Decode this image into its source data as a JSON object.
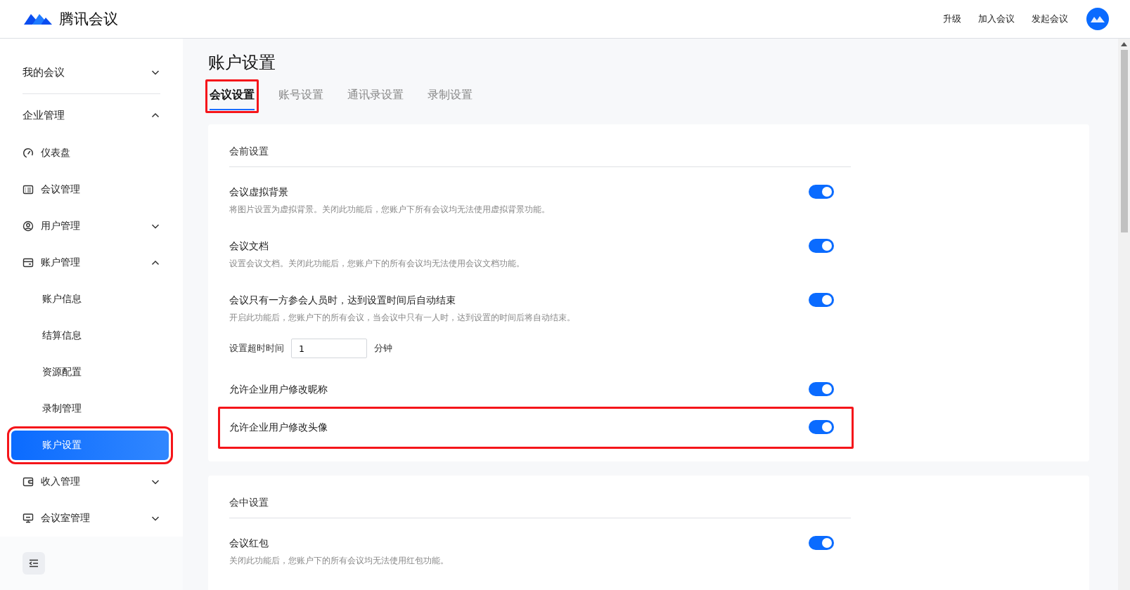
{
  "header": {
    "logo_text": "腾讯会议",
    "links": [
      "升级",
      "加入会议",
      "发起会议"
    ]
  },
  "sidebar": {
    "items": [
      {
        "label": "我的会议",
        "expanded": false,
        "selected": false,
        "highlighted": false
      },
      {
        "label": "企业管理",
        "expanded": true,
        "selected": false,
        "highlighted": false,
        "children": [
          {
            "label": "仪表盘",
            "selected": false,
            "highlighted": false
          },
          {
            "label": "会议管理",
            "selected": false,
            "highlighted": false
          },
          {
            "label": "用户管理",
            "expanded": false,
            "selected": false,
            "highlighted": false
          },
          {
            "label": "账户管理",
            "expanded": true,
            "selected": false,
            "highlighted": false,
            "children": [
              {
                "label": "账户信息",
                "selected": false,
                "highlighted": false
              },
              {
                "label": "结算信息",
                "selected": false,
                "highlighted": false
              },
              {
                "label": "资源配置",
                "selected": false,
                "highlighted": false
              },
              {
                "label": "录制管理",
                "selected": false,
                "highlighted": false
              },
              {
                "label": "账户设置",
                "selected": true,
                "highlighted": true
              }
            ]
          },
          {
            "label": "收入管理",
            "expanded": false,
            "selected": false,
            "highlighted": false
          },
          {
            "label": "会议室管理",
            "expanded": false,
            "selected": false,
            "highlighted": false
          }
        ]
      }
    ]
  },
  "page_title": "账户设置",
  "tabs": [
    {
      "label": "会议设置",
      "selected": true,
      "highlighted": true
    },
    {
      "label": "账号设置",
      "selected": false,
      "highlighted": false
    },
    {
      "label": "通讯录设置",
      "selected": false,
      "highlighted": false
    },
    {
      "label": "录制设置",
      "selected": false,
      "highlighted": false
    }
  ],
  "sections": [
    {
      "title": "会前设置",
      "settings": [
        {
          "label": "会议虚拟背景",
          "description": "将图片设置为虚拟背景。关闭此功能后，您账户下所有会议均无法使用虚拟背景功能。",
          "on": true,
          "highlighted": false
        },
        {
          "label": "会议文档",
          "description": "设置会议文档。关闭此功能后，您账户下的所有会议均无法使用会议文档功能。",
          "on": true,
          "highlighted": false
        },
        {
          "label": "会议只有一方参会人员时，达到设置时间后自动结束",
          "description": "开启此功能后，您账户下的所有会议，当会议中只有一人时，达到设置的时间后将自动结束。",
          "on": true,
          "highlighted": false,
          "timeout": {
            "label": "设置超时时间",
            "value": "1",
            "unit": "分钟"
          }
        },
        {
          "label": "允许企业用户修改昵称",
          "on": true,
          "highlighted": false
        },
        {
          "label": "允许企业用户修改头像",
          "on": true,
          "highlighted": true
        }
      ]
    },
    {
      "title": "会中设置",
      "settings": [
        {
          "label": "会议红包",
          "description": "关闭此功能后，您账户下的所有会议均无法使用红包功能。",
          "on": true,
          "highlighted": false
        }
      ]
    }
  ]
}
